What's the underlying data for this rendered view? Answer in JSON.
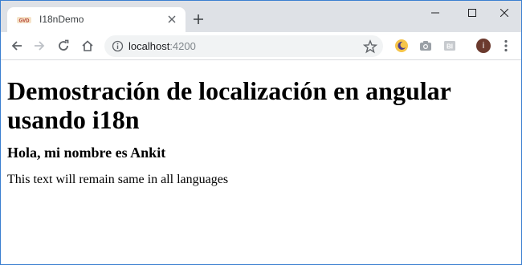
{
  "browser": {
    "tab": {
      "title": "I18nDemo",
      "favicon": "angular-app-favicon-icon"
    },
    "address_bar": {
      "host": "localhost",
      "port": ":4200"
    },
    "extensions": [
      "night-mode-extension-icon",
      "camera-extension-icon",
      "bi-extension-icon"
    ],
    "profile_initial": "i",
    "colors": {
      "tabstrip": "#dee1e6",
      "omnibox": "#f1f3f4",
      "window_border": "#3b7fd0",
      "avatar": "#6b3a2e"
    }
  },
  "page": {
    "heading": "Demostración de localización en angular usando i18n",
    "subheading": "Hola, mi nombre es Ankit",
    "paragraph": "This text will remain same in all languages"
  }
}
